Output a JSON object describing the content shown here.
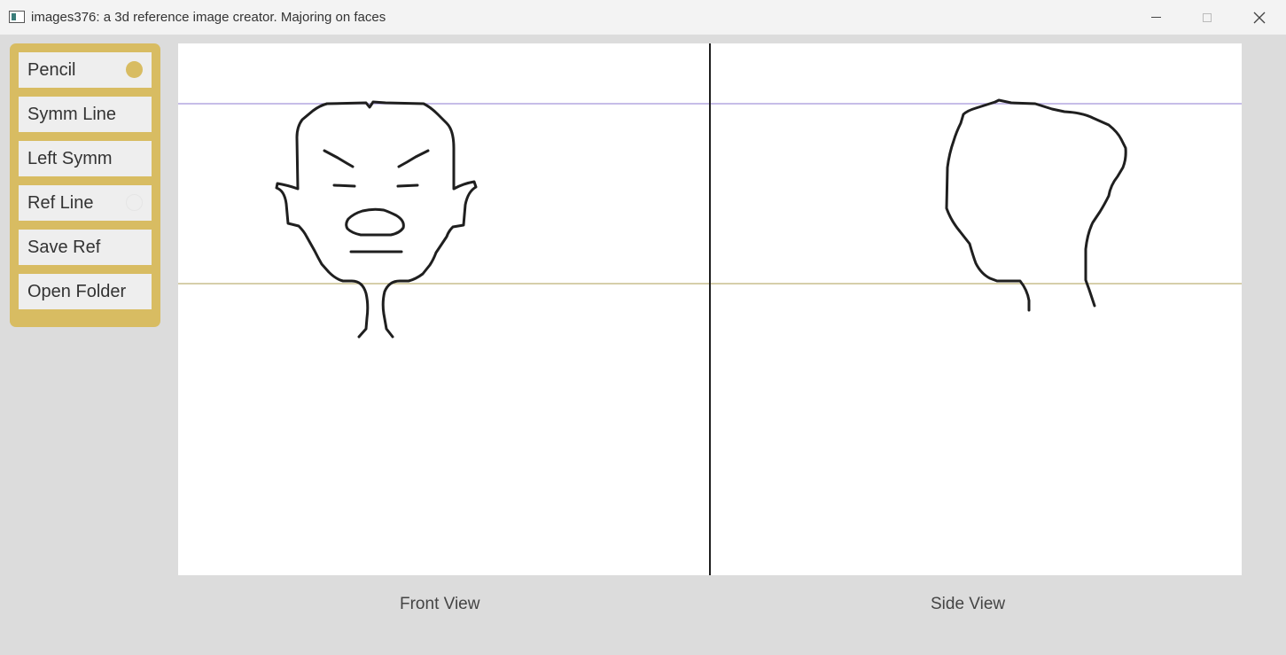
{
  "window": {
    "title": "images376: a 3d reference image creator. Majoring on faces",
    "controls": [
      "minimize",
      "maximize",
      "close"
    ]
  },
  "tools": [
    {
      "label": "Pencil",
      "active": true
    },
    {
      "label": "Symm Line",
      "active": false
    },
    {
      "label": "Left Symm",
      "active": false
    },
    {
      "label": "Ref Line",
      "active": false
    },
    {
      "label": "Save Ref",
      "active": false
    },
    {
      "label": "Open Folder",
      "active": false
    }
  ],
  "views": {
    "front_label": "Front View",
    "side_label": "Side View"
  },
  "colors": {
    "panel": "#d8bc62",
    "top_ref_line": "#b4a7e0",
    "bottom_ref_line": "#c8bf8e",
    "stroke": "#1f1f1f"
  }
}
